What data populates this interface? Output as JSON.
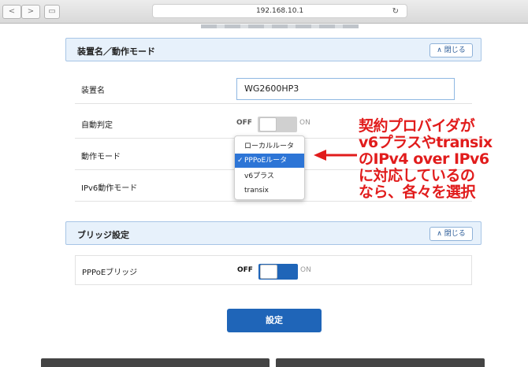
{
  "browser": {
    "url": "192.168.10.1"
  },
  "section1": {
    "title": "装置名／動作モード",
    "close_label": "∧ 閉じる",
    "rows": {
      "device_name": {
        "label": "装置名",
        "value": "WG2600HP3"
      },
      "auto_detect": {
        "label": "自動判定",
        "off_label": "OFF",
        "on_label": "ON"
      },
      "mode": {
        "label": "動作モード"
      },
      "ipv6_mode": {
        "label": "IPv6動作モード"
      }
    },
    "dropdown": {
      "options": [
        "ローカルルータ",
        "PPPoEルータ",
        "v6プラス",
        "transix"
      ],
      "selected_index": 1,
      "check": "✓"
    }
  },
  "section2": {
    "title": "ブリッジ設定",
    "close_label": "∧ 閉じる",
    "rows": {
      "pppoe_bridge": {
        "label": "PPPoEブリッジ",
        "off_label": "OFF",
        "on_label": "ON"
      }
    }
  },
  "submit_label": "設定",
  "annotation": {
    "lines": [
      "契約プロバイダが",
      "v6プラスやtransix",
      "のIPv4 over IPv6",
      "に対応しているの",
      "なら、各々を選択"
    ],
    "color": "#e11c1c"
  },
  "accent_color": "#1f65b8"
}
